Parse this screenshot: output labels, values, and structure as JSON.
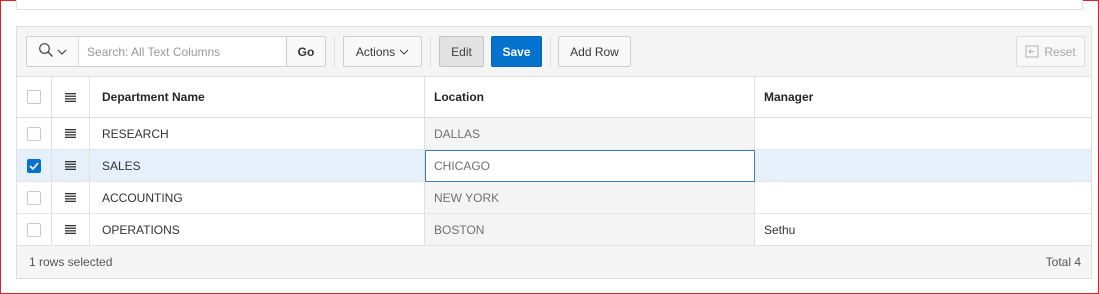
{
  "search": {
    "placeholder": "Search: All Text Columns",
    "go_label": "Go"
  },
  "toolbar": {
    "actions_label": "Actions",
    "edit_label": "Edit",
    "save_label": "Save",
    "add_row_label": "Add Row",
    "reset_label": "Reset"
  },
  "columns": {
    "department": "Department Name",
    "location": "Location",
    "manager": "Manager"
  },
  "rows": [
    {
      "department": "RESEARCH",
      "location": "DALLAS",
      "manager": "",
      "selected": false
    },
    {
      "department": "SALES",
      "location": "CHICAGO",
      "manager": "",
      "selected": true
    },
    {
      "department": "ACCOUNTING",
      "location": "NEW YORK",
      "manager": "",
      "selected": false
    },
    {
      "department": "OPERATIONS",
      "location": "BOSTON",
      "manager": "Sethu",
      "selected": false
    }
  ],
  "footer": {
    "selection_text": "1 rows selected",
    "total_text": "Total 4"
  },
  "colors": {
    "accent": "#0572ce",
    "frame_border": "#d8262b",
    "selected_row": "#e6f0fa"
  },
  "icons": {
    "search": "search-icon",
    "row_menu": "hamburger-icon",
    "reset": "reset-icon",
    "check": "check-icon"
  }
}
